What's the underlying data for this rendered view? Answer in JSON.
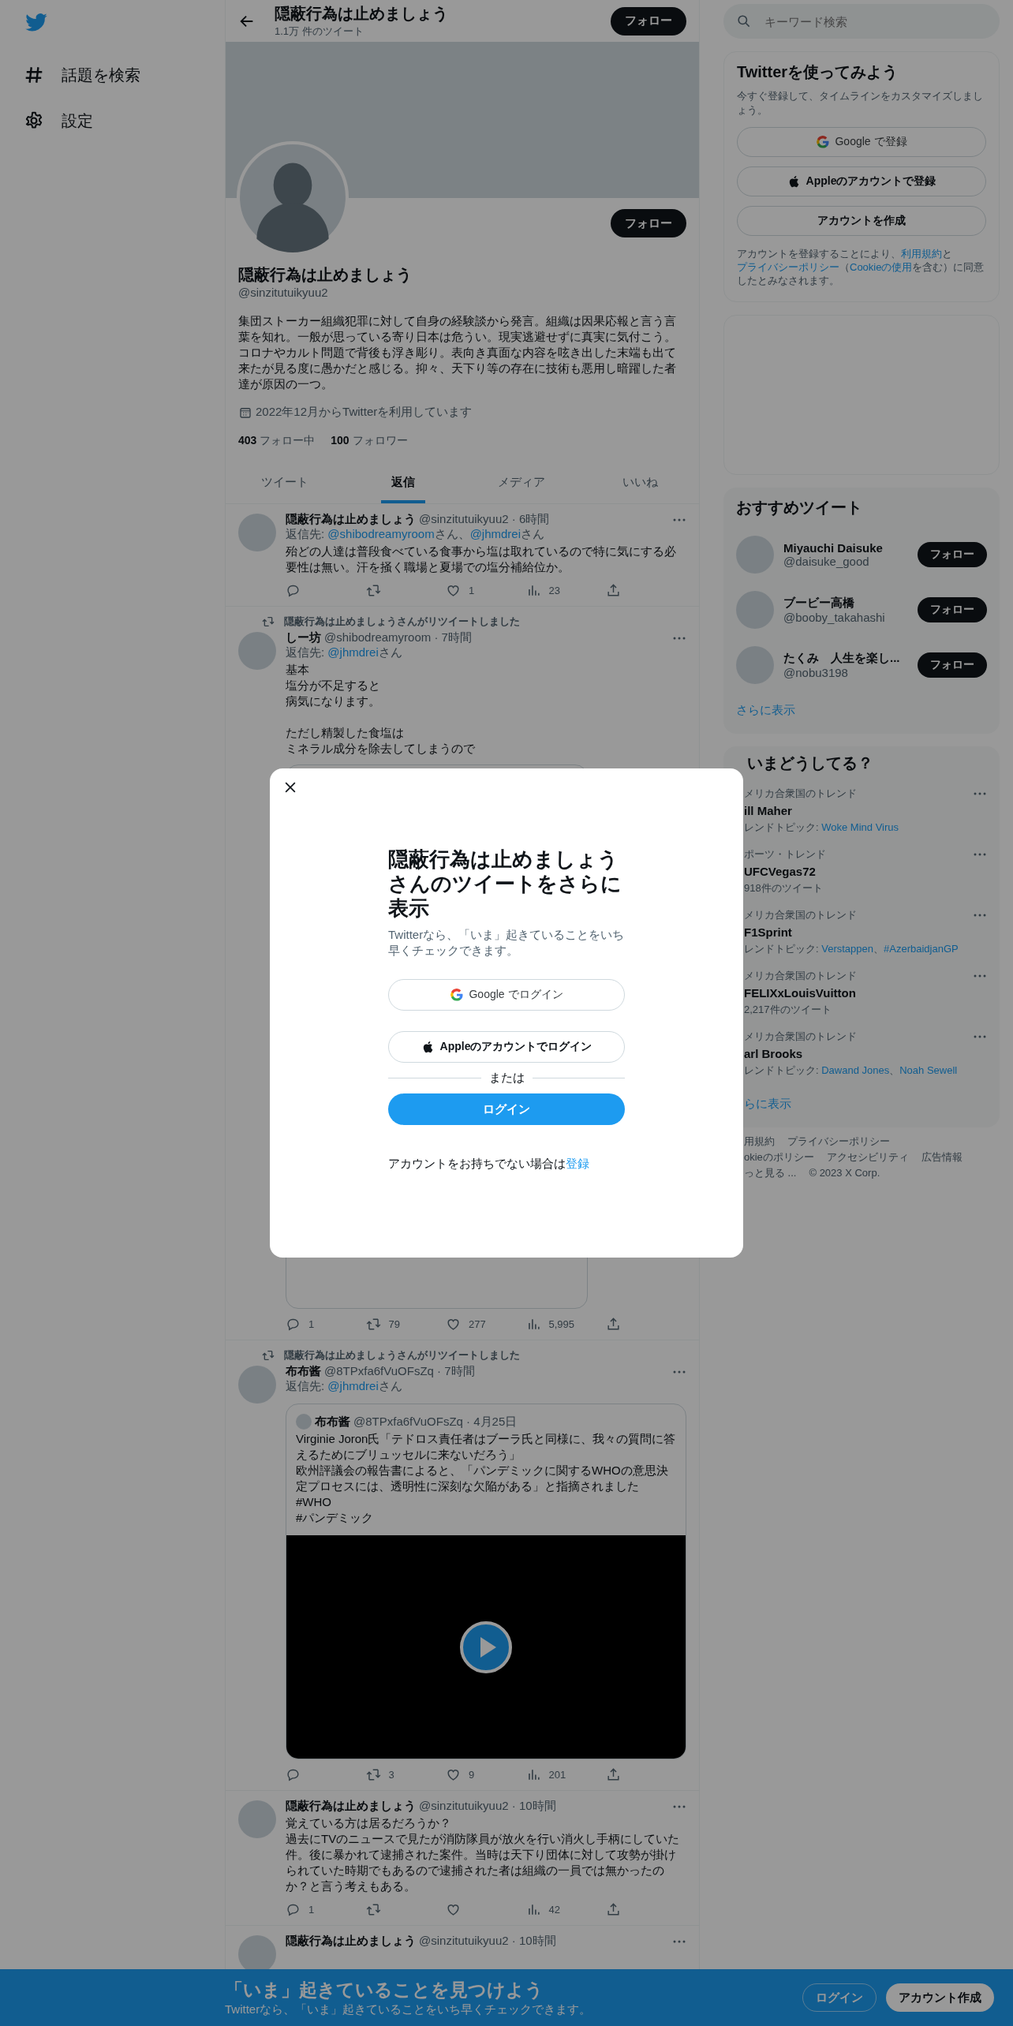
{
  "nav": [
    {
      "kind": "hashtag",
      "label": "話題を検索"
    },
    {
      "kind": "settings",
      "label": "設定"
    }
  ],
  "header": {
    "title": "隠蔽行為は止めましょう",
    "subtitle": "1.1万 件のツイート",
    "follow": "フォロー"
  },
  "profile": {
    "follow": "フォロー",
    "name": "隠蔽行為は止めましょう",
    "handle": "@sinzitutuikyuu2",
    "bio": "集団ストーカー組織犯罪に対して自身の経験談から発言。組織は因果応報と言う言葉を知れ。一般が思っている寄り日本は危うい。現実逃避せずに真実に気付こう。コロナやカルト問題で背後も浮き彫り。表向き真面な内容を呟き出した末端も出て来たが見る度に愚かだと感じる。抑々、天下り等の存在に技術も悪用し暗躍した者達が原因の一つ。",
    "joined": "2022年12月からTwitterを利用しています",
    "following_count": "403",
    "following_label": "フォロー中",
    "followers_count": "100",
    "followers_label": "フォロワー"
  },
  "tabs": [
    {
      "label": "ツイート",
      "selected": false
    },
    {
      "label": "返信",
      "selected": true
    },
    {
      "label": "メディア",
      "selected": false
    },
    {
      "label": "いいね",
      "selected": false
    }
  ],
  "tweets": [
    {
      "name": "隠蔽行為は止めましょう",
      "meta": "@sinzitutuikyuu2 · 6時間",
      "reply_to": {
        "prefix": "返信先: ",
        "mentions": [
          {
            "handle": "@shibodreamyroom",
            "suffix": "さん、"
          },
          {
            "handle": "@jhmdrei",
            "suffix": "さん"
          }
        ]
      },
      "text": [
        [
          "殆どの人達は普段食べている食事から塩は取れているので特に気にする必要性は無い。汗を掻く職場と夏場での塩分補給位か。"
        ]
      ],
      "stats": [
        {
          "kind": "reply"
        },
        {
          "kind": "retweet"
        },
        {
          "kind": "like",
          "count": "1"
        },
        {
          "kind": "views",
          "count": "23"
        },
        {
          "kind": "share"
        }
      ]
    },
    {
      "retweeted_by": "隠蔽行為は止めましょうさんがリツイートしました",
      "name": "しー坊",
      "meta": "@shibodreamyroom · 7時間",
      "reply_to": {
        "prefix": "返信先: ",
        "mentions": [
          {
            "handle": "@jhmdrei",
            "suffix": "さん"
          }
        ]
      },
      "text": [
        [
          "基本",
          "塩分が不足すると",
          "病気になります。"
        ],
        [
          "ただし精製した食塩は",
          "ミネラル成分を除去してしまうので"
        ]
      ],
      "media": {
        "kind": "card"
      },
      "stats": [
        {
          "kind": "reply",
          "count": "1"
        },
        {
          "kind": "retweet",
          "count": "79"
        },
        {
          "kind": "like",
          "count": "277"
        },
        {
          "kind": "views",
          "count": "5,995"
        },
        {
          "kind": "share"
        }
      ]
    },
    {
      "retweeted_by": "隠蔽行為は止めましょうさんがリツイートしました",
      "name": "布布酱",
      "meta": "@8TPxfa6fVuOFsZq · 7時間",
      "reply_to": {
        "prefix": "返信先: ",
        "mentions": [
          {
            "handle": "@jhmdrei",
            "suffix": "さん"
          }
        ]
      },
      "quote": {
        "name": "布布酱",
        "meta": "@8TPxfa6fVuOFsZq · 4月25日",
        "text": [
          "Virginie Joron氏「テドロス責任者はブーラ氏と同様に、我々の質問に答えるためにブリュッセルに来ないだろう」",
          "欧州評議会の報告書によると、「パンデミックに関するWHOの意思決定プロセスには、透明性に深刻な欠陥がある」と指摘されました",
          "#WHO",
          "#パンデミック"
        ],
        "media": {
          "kind": "video"
        }
      },
      "stats": [
        {
          "kind": "reply"
        },
        {
          "kind": "retweet",
          "count": "3"
        },
        {
          "kind": "like",
          "count": "9"
        },
        {
          "kind": "views",
          "count": "201"
        },
        {
          "kind": "share"
        }
      ]
    },
    {
      "name": "隠蔽行為は止めましょう",
      "meta": "@sinzitutuikyuu2 · 10時間",
      "text": [
        [
          "覚えている方は居るだろうか？",
          "過去にTVのニュースで見たが消防隊員が放火を行い消火し手柄にしていた件。後に暴かれて逮捕された案件。当時は天下り団体に対して攻勢が掛けられていた時期でもあるので逮捕された者は組織の一員では無かったのか？と言う考えもある。"
        ]
      ],
      "stats": [
        {
          "kind": "reply",
          "count": "1"
        },
        {
          "kind": "retweet"
        },
        {
          "kind": "like"
        },
        {
          "kind": "views",
          "count": "42"
        },
        {
          "kind": "share"
        }
      ]
    },
    {
      "name": "隠蔽行為は止めましょう",
      "meta": "@sinzitutuikyuu2 · 10時間"
    }
  ],
  "search": {
    "placeholder": "キーワード検索"
  },
  "signup": {
    "title": "Twitterを使ってみよう",
    "subtitle": "今すぐ登録して、タイムラインをカスタマイズしましょう。",
    "buttons": [
      {
        "kind": "google",
        "label": "Google で登録"
      },
      {
        "kind": "apple",
        "label": "Appleのアカウントで登録"
      },
      {
        "kind": "plain",
        "label": "アカウントを作成"
      }
    ],
    "legal": [
      {
        "kind": "text",
        "text": "アカウントを登録することにより、"
      },
      {
        "kind": "link",
        "text": "利用規約"
      },
      {
        "kind": "text",
        "text": "と"
      },
      {
        "kind": "link",
        "text": "プライバシーポリシー"
      },
      {
        "kind": "text",
        "text": "（"
      },
      {
        "kind": "link",
        "text": "Cookieの使用"
      },
      {
        "kind": "text",
        "text": "を含む）に同意したとみなされます。"
      }
    ]
  },
  "recommended": {
    "title": "おすすめツイート",
    "more": "さらに表示",
    "users": [
      {
        "name": "Miyauchi Daisuke",
        "handle": "@daisuke_good",
        "follow": "フォロー"
      },
      {
        "name": "ブービー高橋",
        "handle": "@booby_takahashi",
        "follow": "フォロー"
      },
      {
        "name": "たくみ　人生を楽し...",
        "handle": "@nobu3198",
        "follow": "フォロー"
      }
    ]
  },
  "trends": {
    "title": "いまどうしてる？",
    "more": "らに表示",
    "topic_separator": "、",
    "items": [
      {
        "context": "メリカ合衆国のトレンド",
        "title": "ill Maher",
        "detail": "レンドトピック: ",
        "topics": [
          "Woke Mind Virus"
        ]
      },
      {
        "context": "ポーツ・トレンド",
        "title": "UFCVegas72",
        "detail": "918件のツイート"
      },
      {
        "context": "メリカ合衆国のトレンド",
        "title": "F1Sprint",
        "detail": "レンドトピック: ",
        "topics": [
          "Verstappen",
          "#AzerbaidjanGP"
        ]
      },
      {
        "context": "メリカ合衆国のトレンド",
        "title": "FELIXxLouisVuitton",
        "detail": "2,217件のツイート"
      },
      {
        "context": "メリカ合衆国のトレンド",
        "title": "arl Brooks",
        "detail": "レンドトピック: ",
        "topics": [
          "Dawand Jones",
          "Noah Sewell"
        ]
      }
    ]
  },
  "footer": {
    "rows": [
      [
        "用規約",
        "プライバシーポリシー"
      ],
      [
        "okieのポリシー",
        "アクセシビリティ",
        "広告情報"
      ],
      [
        "っと見る ..."
      ]
    ],
    "copyright": "© 2023 X Corp."
  },
  "modal": {
    "title": "隠蔽行為は止めましょうさんのツイートをさらに表示",
    "subtitle": "Twitterなら、「いま」起きていることをいち早くチェックできます。",
    "buttons": [
      {
        "kind": "google",
        "label": "Google でログイン"
      },
      {
        "kind": "apple",
        "label": "Appleのアカウントでログイン"
      }
    ],
    "divider": "または",
    "login": "ログイン",
    "signup_text": "アカウントをお持ちでない場合は",
    "signup_link": "登録"
  },
  "bottom_bar": {
    "title": "「いま」起きていることを見つけよう",
    "subtitle": "Twitterなら、「いま」起きていることをいち早くチェックできます。",
    "login": "ログイン",
    "signup": "アカウント作成"
  }
}
